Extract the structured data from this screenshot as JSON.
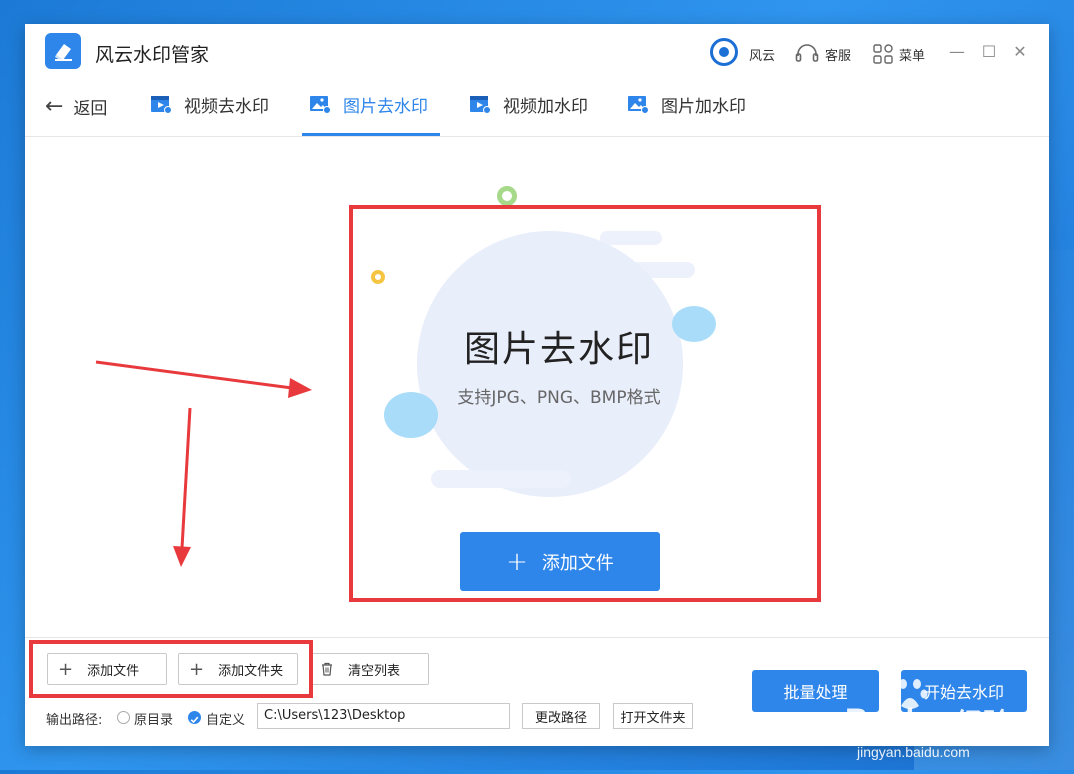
{
  "app": {
    "title": "风云水印管家"
  },
  "titlebar": {
    "brand_label": "风云",
    "service_label": "客服",
    "menu_label": "菜单",
    "minimize_glyph": "—",
    "maximize_glyph": "☐",
    "close_glyph": "✕"
  },
  "nav": {
    "back_label": "返回",
    "tabs": [
      {
        "label": "视频去水印",
        "icon": "video-icon",
        "active": false
      },
      {
        "label": "图片去水印",
        "icon": "image-icon",
        "active": true
      },
      {
        "label": "视频加水印",
        "icon": "video-icon",
        "active": false
      },
      {
        "label": "图片加水印",
        "icon": "image-icon",
        "active": false
      }
    ]
  },
  "dropzone": {
    "title": "图片去水印",
    "subtitle": "支持JPG、PNG、BMP格式",
    "add_button_label": "添加文件"
  },
  "bottom": {
    "add_file_label": "添加文件",
    "add_folder_label": "添加文件夹",
    "clear_list_label": "清空列表",
    "output_path_label": "输出路径:",
    "radio_original": "原目录",
    "radio_custom": "自定义",
    "selected_radio": "自定义",
    "path_value": "C:\\Users\\123\\Desktop",
    "change_path_label": "更改路径",
    "open_folder_label": "打开文件夹",
    "batch_label": "批量处理",
    "start_label": "开始去水印"
  },
  "watermark": {
    "brand": "Baidu",
    "brand_cn": "经验",
    "url": "jingyan.baidu.com"
  },
  "colors": {
    "accent": "#2f86ea",
    "highlight": "#e8393d",
    "brand_dark": "#1c6fd4"
  }
}
